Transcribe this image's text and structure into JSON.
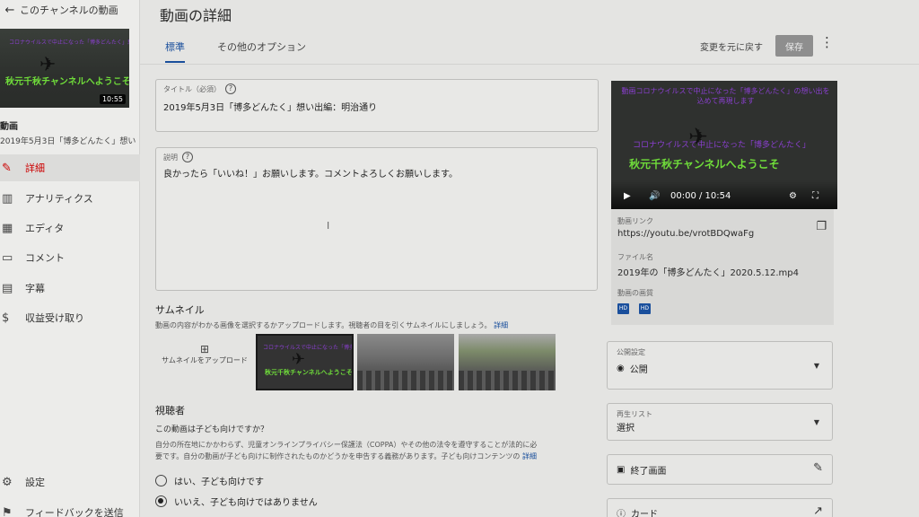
{
  "sidebar": {
    "back_label": "このチャンネルの動画",
    "thumb": {
      "duration": "10:55",
      "green_text": "秋元千秋チャンネルへようこそ",
      "purple_text": "コロナウイルスで中止になった「博多どんたく」思い出"
    },
    "video_label": "動画",
    "video_sub": "2019年5月3日「博多どんたく」想い...",
    "nav": [
      {
        "label": "詳細",
        "icon": "pencil-icon",
        "active": true
      },
      {
        "label": "アナリティクス",
        "icon": "chart-icon",
        "active": false
      },
      {
        "label": "エディタ",
        "icon": "film-icon",
        "active": false
      },
      {
        "label": "コメント",
        "icon": "comment-icon",
        "active": false
      },
      {
        "label": "字幕",
        "icon": "subtitles-icon",
        "active": false
      },
      {
        "label": "収益受け取り",
        "icon": "dollar-icon",
        "active": false
      }
    ],
    "settings_label": "設定",
    "feedback_label": "フィードバックを送信"
  },
  "header": {
    "title": "動画の詳細",
    "tabs": [
      "標準",
      "その他のオプション"
    ],
    "undo_label": "変更を元に戻す",
    "save_label": "保存"
  },
  "form": {
    "title_label": "タイトル（必須）",
    "title_value": "2019年5月3日「博多どんたく」想い出編：明治通り",
    "desc_label": "説明",
    "desc_value": "良かったら「いいね！」お願いします。コメントよろしくお願いします。"
  },
  "thumbnail": {
    "heading": "サムネイル",
    "desc": "動画の内容がわかる画像を選択するかアップロードします。視聴者の目を引くサムネイルにしましょう。",
    "link": "詳細",
    "upload_label": "サムネイルをアップロード"
  },
  "audience": {
    "heading": "視聴者",
    "question": "この動画は子ども向けですか？",
    "desc_line1": "自分の所在地にかかわらず、児童オンラインプライバシー保護法（COPPA）やその他の法令を遵守することが法的に必",
    "desc_line2": "要です。自分の動画が子ども向けに制作されたものかどうかを申告する義務があります。子ども向けコンテンツの",
    "link": "詳細",
    "option_yes": "はい、子ども向けです",
    "option_no": "いいえ、子ども向けではありません",
    "selected": "no"
  },
  "player": {
    "banner": "動画コロナウイルスで中止になった「博多どんたく」の想い出を込めて再現します",
    "overlay_purple": "コロナウイルスで中止になった「博多どんたく」",
    "overlay_green": "秋元千秋チャンネルへようこそ",
    "time": "00:00 / 10:54"
  },
  "video_info": {
    "link_label": "動画リンク",
    "link_value": "https://youtu.be/vrotBDQwaFg",
    "file_label": "ファイル名",
    "file_value": "2019年の「博多どんたく」2020.5.12.mp4",
    "quality_label": "動画の画質",
    "quality_badges": [
      "HD",
      "HD"
    ]
  },
  "right_panel": {
    "visibility_label": "公開設定",
    "visibility_value": "公開",
    "playlist_label": "再生リスト",
    "playlist_value": "選択",
    "end_screen_label": "終了画面",
    "cards_label": "カード"
  }
}
